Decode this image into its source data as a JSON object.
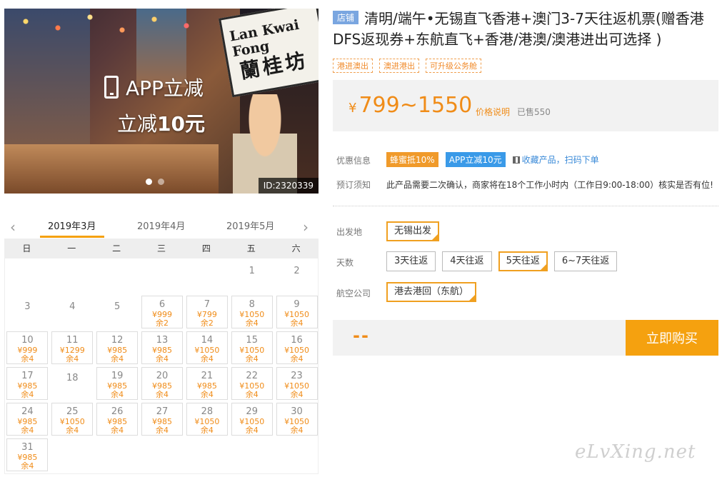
{
  "hero": {
    "promo_line1": "APP立减",
    "promo_line2_pre": "立减",
    "promo_line2_amount": "10元",
    "sign_en": "Lan Kwai Fong",
    "sign_zh": "蘭桂坊",
    "id_tag": "ID:2320339",
    "slide_count": 2,
    "active_slide": 1
  },
  "product": {
    "shop_badge": "店铺",
    "title": "清明/端午•无锡直飞香港+澳门3-7天往返机票(赠香港DFS返现券+东航直飞+香港/港澳/澳港进出可选择 )",
    "tags": [
      "港进澳出",
      "澳进港出",
      "可升级公务舱"
    ],
    "price_currency": "¥",
    "price_range": "799~1550",
    "price_desc": "价格说明",
    "sold": "已售550"
  },
  "info": {
    "promo_label": "优惠信息",
    "promo_badge_1": "蜂蜜抵10%",
    "promo_badge_2": "APP立减10元",
    "fav_text": "收藏产品，扫码下单",
    "notice_label": "预订须知",
    "notice_text": "此产品需要二次确认，商家将在18个工作小时内（工作日9:00-18:00）核实是否有位!"
  },
  "options": {
    "departure_label": "出发地",
    "departures": [
      {
        "label": "无锡出发",
        "selected": true
      }
    ],
    "days_label": "天数",
    "days": [
      {
        "label": "3天往返",
        "selected": false
      },
      {
        "label": "4天往返",
        "selected": false
      },
      {
        "label": "5天往返",
        "selected": true
      },
      {
        "label": "6~7天往返",
        "selected": false
      }
    ],
    "airline_label": "航空公司",
    "airlines": [
      {
        "label": "港去港回（东航）",
        "selected": true
      }
    ]
  },
  "buy": {
    "price_placeholder": "--",
    "button_label": "立即购买"
  },
  "watermark": "eLvXing.net",
  "calendar": {
    "months": [
      "2019年3月",
      "2019年4月",
      "2019年5月"
    ],
    "active_month": 0,
    "weekdays": [
      "日",
      "一",
      "二",
      "三",
      "四",
      "五",
      "六"
    ],
    "first_weekday": 5,
    "days": [
      {
        "d": "1"
      },
      {
        "d": "2"
      },
      {
        "d": "3"
      },
      {
        "d": "4"
      },
      {
        "d": "5"
      },
      {
        "d": "6",
        "p": "¥999",
        "r": "余2"
      },
      {
        "d": "7",
        "p": "¥799",
        "r": "余2"
      },
      {
        "d": "8",
        "p": "¥1050",
        "r": "余4"
      },
      {
        "d": "9",
        "p": "¥1050",
        "r": "余4"
      },
      {
        "d": "10",
        "p": "¥999",
        "r": "余4"
      },
      {
        "d": "11",
        "p": "¥1299",
        "r": "余4"
      },
      {
        "d": "12",
        "p": "¥985",
        "r": "余4"
      },
      {
        "d": "13",
        "p": "¥985",
        "r": "余4"
      },
      {
        "d": "14",
        "p": "¥1050",
        "r": "余4"
      },
      {
        "d": "15",
        "p": "¥1050",
        "r": "余4"
      },
      {
        "d": "16",
        "p": "¥1050",
        "r": "余4"
      },
      {
        "d": "17",
        "p": "¥985",
        "r": "余4"
      },
      {
        "d": "18"
      },
      {
        "d": "19",
        "p": "¥985",
        "r": "余4"
      },
      {
        "d": "20",
        "p": "¥985",
        "r": "余4"
      },
      {
        "d": "21",
        "p": "¥985",
        "r": "余4"
      },
      {
        "d": "22",
        "p": "¥1050",
        "r": "余4"
      },
      {
        "d": "23",
        "p": "¥1050",
        "r": "余4"
      },
      {
        "d": "24",
        "p": "¥985",
        "r": "余4"
      },
      {
        "d": "25",
        "p": "¥1050",
        "r": "余4"
      },
      {
        "d": "26",
        "p": "¥985",
        "r": "余4"
      },
      {
        "d": "27",
        "p": "¥985",
        "r": "余4"
      },
      {
        "d": "28",
        "p": "¥1050",
        "r": "余4"
      },
      {
        "d": "29",
        "p": "¥1050",
        "r": "余4"
      },
      {
        "d": "30",
        "p": "¥1050",
        "r": "余4"
      },
      {
        "d": "31",
        "p": "¥985",
        "r": "余4"
      }
    ]
  },
  "colors": {
    "accent": "#f5a10f",
    "price": "#f08c18",
    "link": "#3a8ad8",
    "shop_badge": "#7aa6e0"
  }
}
